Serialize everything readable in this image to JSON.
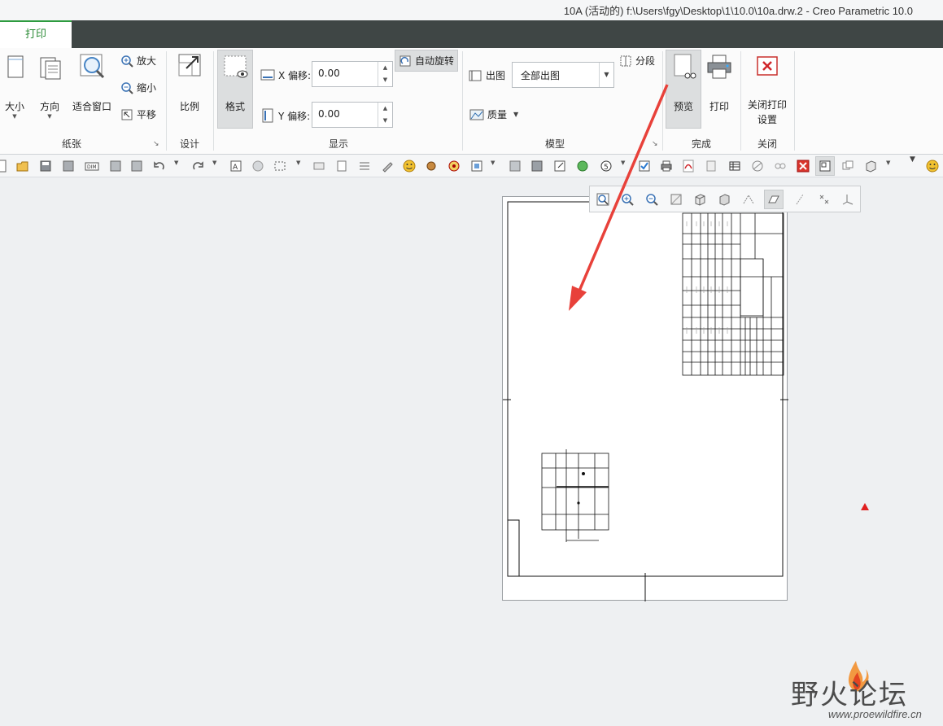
{
  "window": {
    "title": "10A (活动的) f:\\Users\\fgy\\Desktop\\1\\10.0\\10a.drw.2 - Creo Parametric 10.0"
  },
  "tabs": [
    {
      "label": "打印"
    }
  ],
  "ribbon": {
    "paper": {
      "group_label": "纸张",
      "size_label": "大小",
      "orientation_label": "方向",
      "fit_window_label": "适合窗口",
      "zoom_in_label": "放大",
      "zoom_out_label": "缩小",
      "pan_label": "平移"
    },
    "design": {
      "group_label": "设计",
      "scale_label": "比例"
    },
    "display": {
      "group_label": "显示",
      "format_label": "格式",
      "x_offset_label": "X 偏移:",
      "x_offset_value": "0.00",
      "y_offset_label": "Y 偏移:",
      "y_offset_value": "0.00",
      "auto_rotate_label": "自动旋转"
    },
    "model": {
      "group_label": "模型",
      "output_label": "出图",
      "output_value": "全部出图",
      "quality_label": "质量",
      "segment_label": "分段"
    },
    "finish": {
      "group_label": "完成",
      "preview_label": "预览",
      "print_label": "打印"
    },
    "close": {
      "group_label": "关闭",
      "close_print_label_1": "关闭打印",
      "close_print_label_2": "设置"
    }
  },
  "watermark": {
    "text": "野火论坛",
    "url": "www.proewildfire.cn"
  },
  "colors": {
    "accent": "#2d9b3f",
    "tabstrip": "#3f4645",
    "arrow": "#e8413a"
  }
}
